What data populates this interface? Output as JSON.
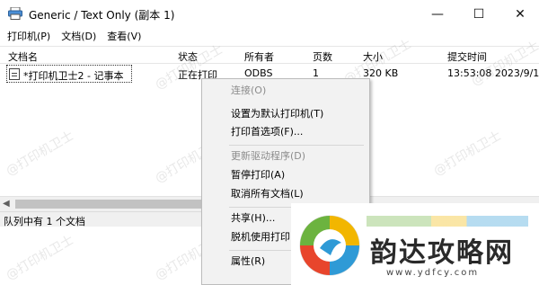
{
  "window": {
    "title": "Generic / Text Only (副本 1)",
    "minimize_glyph": "—",
    "maximize_glyph": "☐",
    "close_glyph": "✕"
  },
  "menubar": {
    "items": [
      {
        "label": "打印机(P)"
      },
      {
        "label": "文档(D)"
      },
      {
        "label": "查看(V)"
      }
    ]
  },
  "columns": {
    "headers": [
      "文档名",
      "状态",
      "所有者",
      "页数",
      "大小",
      "提交时间"
    ]
  },
  "jobs": [
    {
      "name": "*打印机卫士2 - 记事本",
      "status": "正在打印",
      "owner": "ODBS",
      "pages": "1",
      "size": "320 KB",
      "submitted": "13:53:08  2023/9/1"
    }
  ],
  "statusbar": {
    "text": "队列中有 1 个文档"
  },
  "context_menu": {
    "items": [
      {
        "label": "连接(O)",
        "disabled": true
      },
      {
        "label": "设置为默认打印机(T)",
        "disabled": false
      },
      {
        "label": "打印首选项(F)...",
        "disabled": false
      },
      {
        "label": "更新驱动程序(D)",
        "disabled": true
      },
      {
        "label": "暂停打印(A)",
        "disabled": false
      },
      {
        "label": "取消所有文档(L)",
        "disabled": false
      },
      {
        "label": "共享(H)...",
        "disabled": false
      },
      {
        "label": "脱机使用打印",
        "disabled": false
      },
      {
        "label": "属性(R)",
        "disabled": false
      }
    ]
  },
  "watermark": {
    "text": "@打印机卫士"
  },
  "brand": {
    "name": "韵达攻略网",
    "url": "www.ydfcy.com"
  },
  "icons": {
    "app": "printer-icon",
    "document": "document-icon",
    "scroll_left": "chevron-left-icon"
  },
  "colors": {
    "context_menu_bg": "#f2f2f2",
    "disabled_text": "#8c8c8c",
    "statusbar_bg": "#f0f0f0"
  }
}
